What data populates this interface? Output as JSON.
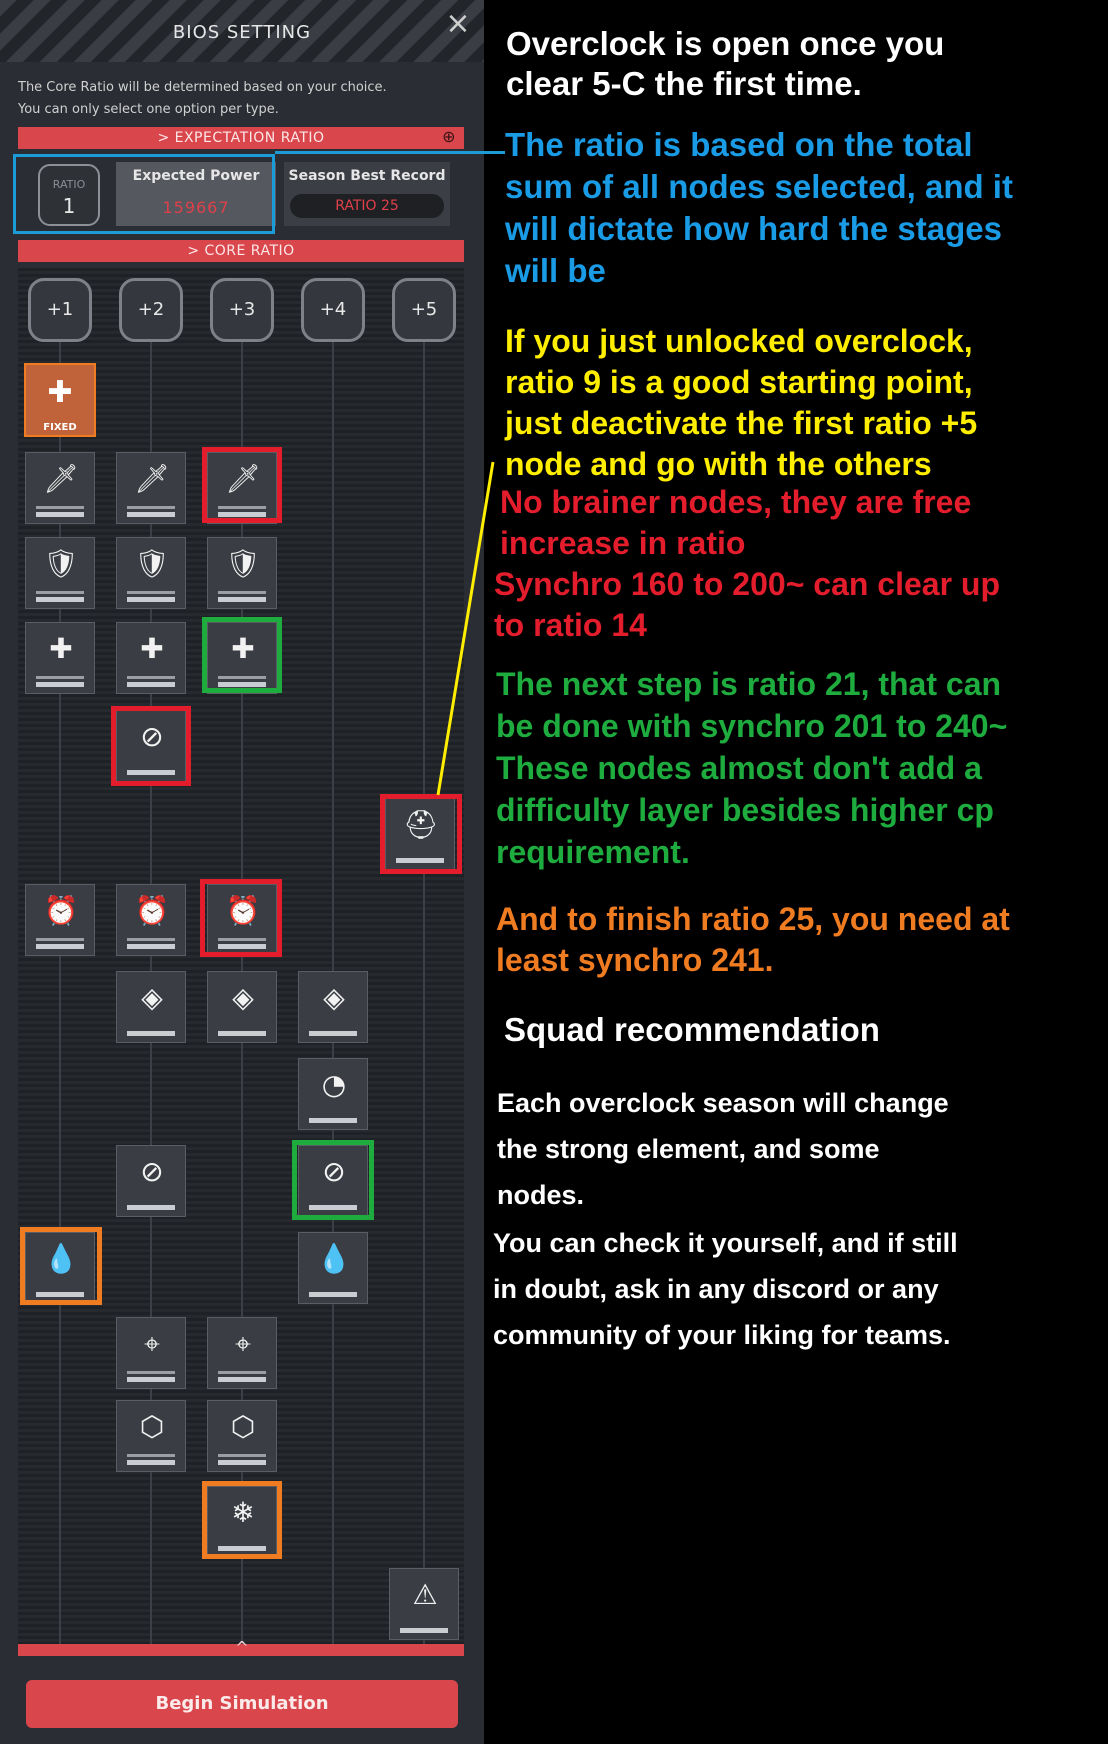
{
  "panel": {
    "title": "BIOS SETTING",
    "close_icon": "×",
    "description_line1": "The Core Ratio will be determined based on your choice.",
    "description_line2": "You can only select one option per type.",
    "expectation_header": "> EXPECTATION RATIO",
    "zoom_icon": "⊕",
    "ratio_label": "RATIO",
    "ratio_value": "1",
    "expected_power_label": "Expected Power",
    "expected_power_value": "159667",
    "season_best_label": "Season Best Record",
    "season_best_value": "RATIO 25",
    "core_ratio_header": "> CORE RATIO",
    "columns": [
      "+1",
      "+2",
      "+3",
      "+4",
      "+5"
    ],
    "fixed_label": "FIXED",
    "begin_button": "Begin Simulation",
    "chevron": "^"
  },
  "nodes": {
    "attack": "🗡",
    "defense": "🛡",
    "heal": "✚",
    "no_burst": "⊘",
    "helmet": "⛑",
    "alarm": "⏰",
    "cover": "◈",
    "reload": "◔",
    "no_core": "⊘",
    "element_water": "💧",
    "crosshair": "⌖",
    "hexagon": "⬡",
    "freeze": "❄",
    "warning": "⚠",
    "fixed": "✚"
  },
  "annotations": {
    "unlock": [
      "Overclock is open once you",
      "clear 5-C the first time."
    ],
    "ratio_info": [
      "The ratio is based on the total",
      "sum of all nodes selected, and it",
      "will dictate how hard the stages",
      "will be"
    ],
    "starting": [
      "If you just unlocked overclock,",
      "ratio 9 is a good starting point,",
      "just deactivate the first ratio +5",
      "node and go with the others"
    ],
    "no_brainer": [
      "No brainer nodes, they are free",
      "increase in ratio",
      "Synchro 160 to 200~ can clear up",
      "to ratio 14"
    ],
    "next_step": [
      "The next step is ratio 21, that can",
      "be done with synchro 201 to 240~",
      "These nodes almost don't add a",
      "difficulty layer besides higher cp",
      "requirement."
    ],
    "finish": [
      "And to finish ratio 25, you need at",
      "least synchro 241."
    ],
    "squad_title": "Squad recommendation",
    "squad_para1": [
      "Each overclock season will change",
      "the strong element, and some",
      "nodes."
    ],
    "squad_para2": [
      "You can check it yourself, and if still",
      "in doubt, ask in any discord or any",
      "community of your liking for teams."
    ]
  },
  "colors": {
    "blue": "#1a9be6",
    "yellow": "#ffee00",
    "red": "#e41d2d",
    "green": "#1eac3f",
    "orange": "#f07c22",
    "panel_red": "#d9474d"
  }
}
